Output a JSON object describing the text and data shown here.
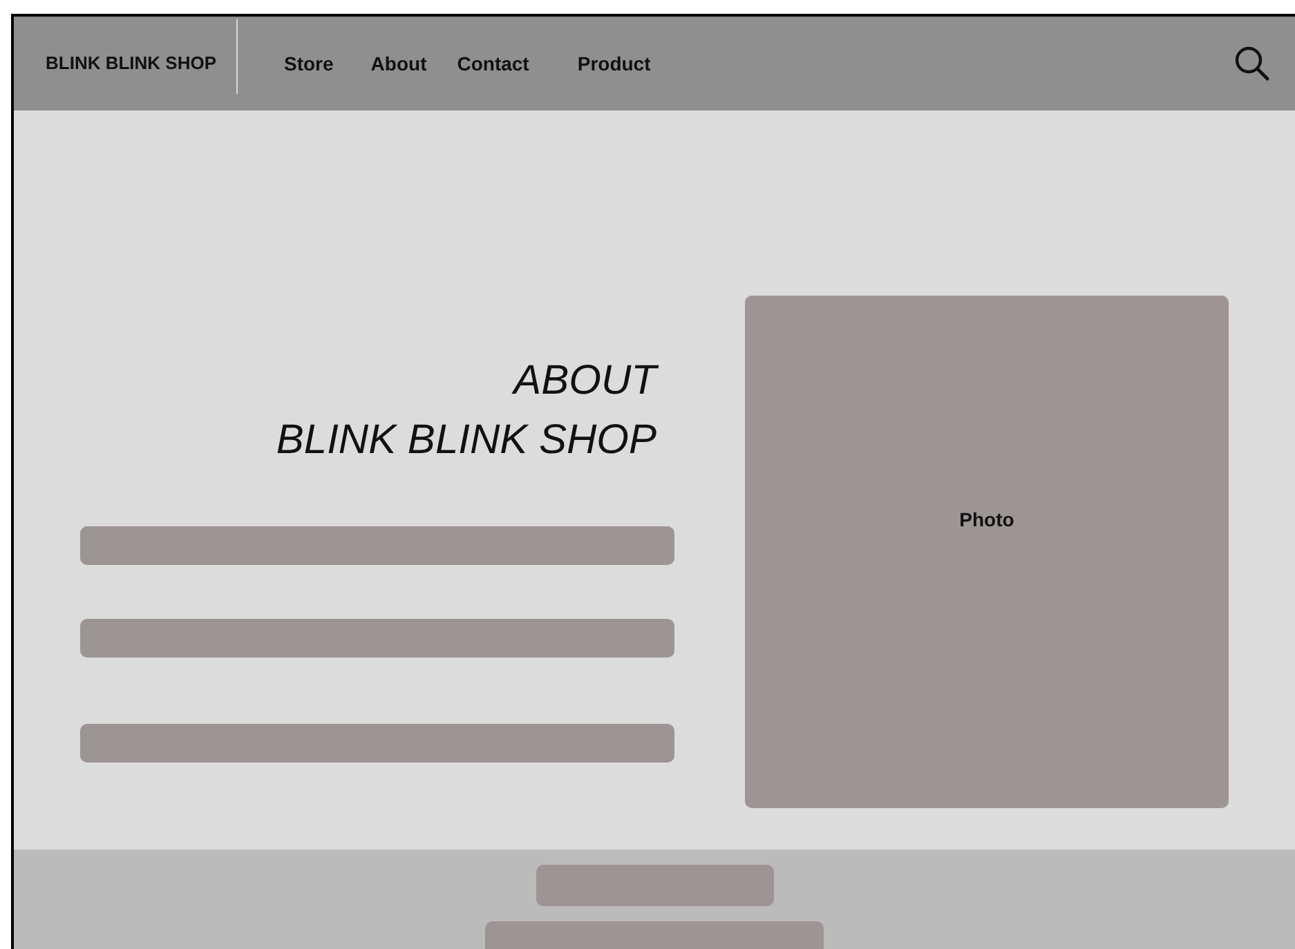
{
  "navbar": {
    "brand": "BLINK BLINK SHOP",
    "links": [
      {
        "label": "Store"
      },
      {
        "label": "About"
      },
      {
        "label": "Contact"
      },
      {
        "label": "Product"
      }
    ],
    "search": {
      "kind": "search"
    }
  },
  "about": {
    "heading_lines": [
      "ABOUT",
      "BLINK BLINK SHOP"
    ],
    "text_bars": [
      {
        "kind": "bar"
      },
      {
        "kind": "bar"
      },
      {
        "kind": "bar"
      }
    ],
    "photo": {
      "label": "Photo"
    }
  },
  "footer": {
    "bars": [
      {
        "kind": "short"
      },
      {
        "kind": "long"
      }
    ]
  }
}
